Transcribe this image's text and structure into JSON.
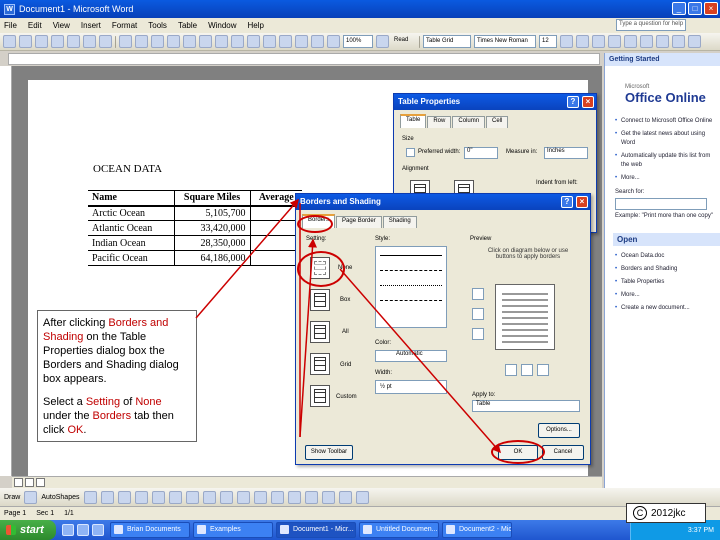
{
  "window": {
    "title": "Document1 - Microsoft Word",
    "help_placeholder": "Type a question for help"
  },
  "menu": [
    "File",
    "Edit",
    "View",
    "Insert",
    "Format",
    "Tools",
    "Table",
    "Window",
    "Help"
  ],
  "toolbar": {
    "zoom": "100%",
    "read_label": "Read",
    "style": "Table Grid",
    "font": "Times New Roman",
    "size": "12"
  },
  "document": {
    "title": "OCEAN DATA",
    "headers": [
      "Name",
      "Square Miles",
      "Average"
    ],
    "rows": [
      [
        "Arctic Ocean",
        "5,105,700"
      ],
      [
        "Atlantic Ocean",
        "33,420,000"
      ],
      [
        "Indian Ocean",
        "28,350,000"
      ],
      [
        "Pacific Ocean",
        "64,186,000"
      ]
    ]
  },
  "callout": {
    "p1_a": "After clicking ",
    "p1_b": "Borders and Shading",
    "p1_c": " on the Table Properties dialog box the Borders and Shading dialog box appears.",
    "p2_a": "Select a ",
    "p2_b": "Setting",
    "p2_c": " of ",
    "p2_d": "None",
    "p2_e": " under the ",
    "p2_f": "Borders",
    "p2_g": " tab then click ",
    "p2_h": "OK",
    "p2_i": "."
  },
  "table_properties": {
    "title": "Table Properties",
    "tabs": [
      "Table",
      "Row",
      "Column",
      "Cell"
    ],
    "size_label": "Size",
    "preferred_width": "Preferred width:",
    "width_value": "0\"",
    "measure_in": "Measure in:",
    "measure_value": "Inches",
    "alignment": "Alignment",
    "indent_from_left": "Indent from left:"
  },
  "borders_shading": {
    "title": "Borders and Shading",
    "tabs": [
      "Borders",
      "Page Border",
      "Shading"
    ],
    "setting_label": "Setting:",
    "settings": [
      "None",
      "Box",
      "All",
      "Grid",
      "Custom"
    ],
    "style_label": "Style:",
    "color_label": "Color:",
    "color_value": "Automatic",
    "width_label": "Width:",
    "width_value": "½ pt",
    "preview_label": "Preview",
    "preview_hint": "Click on diagram below or use buttons to apply borders",
    "apply_to_label": "Apply to:",
    "apply_to_value": "Table",
    "options_button": "Options...",
    "show_toolbar_button": "Show Toolbar",
    "ok_button": "OK",
    "cancel_button": "Cancel"
  },
  "taskpane": {
    "title": "Getting Started",
    "brand_small": "Microsoft",
    "brand": "Office Online",
    "links": [
      "Connect to Microsoft Office Online",
      "Get the latest news about using Word",
      "Automatically update this list from the web",
      "More..."
    ],
    "search_label": "Search for:",
    "example": "Example: \"Print more than one copy\"",
    "open_title": "Open",
    "open_items": [
      "Ocean Data.doc",
      "Borders and Shading",
      "Table Properties",
      "More..."
    ],
    "create_new": "Create a new document..."
  },
  "drawbar": {
    "draw_label": "Draw",
    "autoshapes_label": "AutoShapes"
  },
  "statusbar": {
    "page": "Page 1",
    "sec": "Sec 1",
    "pos": "1/1"
  },
  "taskbar": {
    "start": "start",
    "items": [
      "Brian Documents",
      "Examples",
      "Document1 - Micr...",
      "Untitled Documen...",
      "Document2 - Micr..."
    ],
    "clock": "3:37 PM"
  },
  "copyright": {
    "symbol": "C",
    "text": "2012jkc"
  }
}
